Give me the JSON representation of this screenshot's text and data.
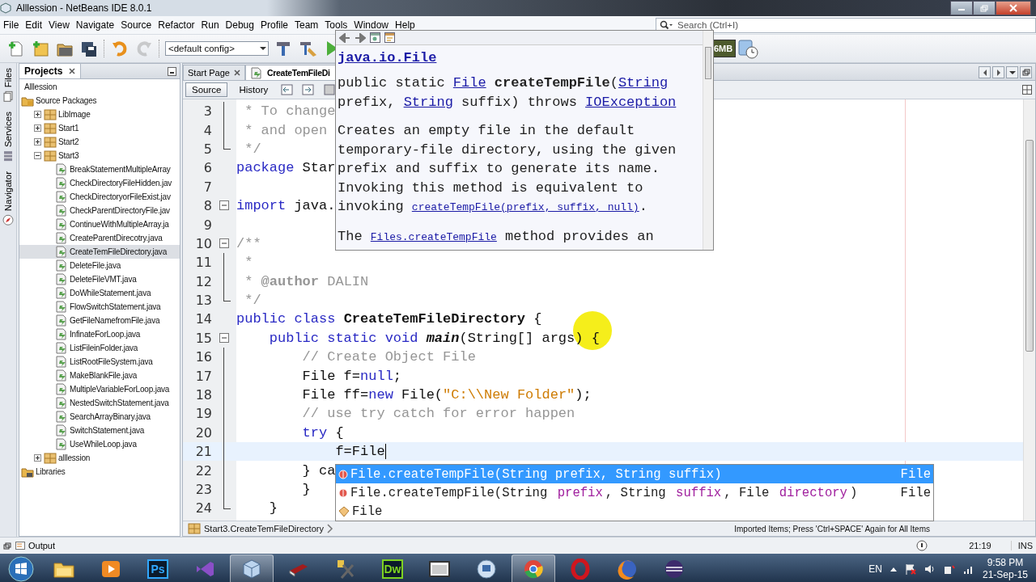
{
  "window": {
    "title": "Alllession - NetBeans IDE 8.0.1"
  },
  "menu": [
    "File",
    "Edit",
    "View",
    "Navigate",
    "Source",
    "Refactor",
    "Run",
    "Debug",
    "Profile",
    "Team",
    "Tools",
    "Window",
    "Help"
  ],
  "search": {
    "placeholder": "Search (Ctrl+I)"
  },
  "toolbar": {
    "config": "<default config>",
    "memory": "6MB",
    "redo_disabled": true
  },
  "side_tabs": [
    {
      "label": "Files",
      "kind": "files"
    },
    {
      "label": "Services",
      "kind": "services"
    },
    {
      "label": "Navigator",
      "kind": "navigator"
    }
  ],
  "projects": {
    "title": "Projects",
    "tree": [
      {
        "label": "Alllession",
        "selected": false,
        "children": [
          {
            "label": "Source Packages",
            "kind": "folder",
            "selected": false,
            "children": [
              {
                "label": "LibImage",
                "kind": "package",
                "expanded": false,
                "selected": false
              },
              {
                "label": "Start1",
                "kind": "package",
                "expanded": false,
                "selected": false
              },
              {
                "label": "Start2",
                "kind": "package",
                "expanded": false,
                "selected": false
              },
              {
                "label": "Start3",
                "kind": "package",
                "expanded": true,
                "selected": false,
                "children": [
                  {
                    "label": "BreakStatementMultipleArray",
                    "kind": "file",
                    "selected": false
                  },
                  {
                    "label": "CheckDirectoryFileHidden.jav",
                    "kind": "file",
                    "selected": false
                  },
                  {
                    "label": "CheckDirectoryorFileExist.jav",
                    "kind": "file",
                    "selected": false
                  },
                  {
                    "label": "CheckParentDirectoryFile.jav",
                    "kind": "file",
                    "selected": false
                  },
                  {
                    "label": "ContinueWithMultipleArray.ja",
                    "kind": "file",
                    "selected": false
                  },
                  {
                    "label": "CreateParentDirecotry.java",
                    "kind": "file",
                    "selected": false
                  },
                  {
                    "label": "CreateTemFileDirectory.java",
                    "kind": "file",
                    "selected": true
                  },
                  {
                    "label": "DeleteFile.java",
                    "kind": "file",
                    "selected": false
                  },
                  {
                    "label": "DeleteFileVMT.java",
                    "kind": "file",
                    "selected": false
                  },
                  {
                    "label": "DoWhileStatement.java",
                    "kind": "file",
                    "selected": false
                  },
                  {
                    "label": "FlowSwitchStatement.java",
                    "kind": "file",
                    "selected": false
                  },
                  {
                    "label": "GetFileNamefromFile.java",
                    "kind": "file",
                    "selected": false
                  },
                  {
                    "label": "InfinateForLoop.java",
                    "kind": "file",
                    "selected": false
                  },
                  {
                    "label": "ListFileinFolder.java",
                    "kind": "file",
                    "selected": false
                  },
                  {
                    "label": "ListRootFileSystem.java",
                    "kind": "file",
                    "selected": false
                  },
                  {
                    "label": "MakeBlankFile.java",
                    "kind": "file",
                    "selected": false
                  },
                  {
                    "label": "MultipleVariableForLoop.java",
                    "kind": "file",
                    "selected": false
                  },
                  {
                    "label": "NestedSwitchStatement.java",
                    "kind": "file",
                    "selected": false
                  },
                  {
                    "label": "SearchArrayBinary.java",
                    "kind": "file",
                    "selected": false
                  },
                  {
                    "label": "SwitchStatement.java",
                    "kind": "file",
                    "selected": false
                  },
                  {
                    "label": "UseWhileLoop.java",
                    "kind": "file",
                    "selected": false
                  }
                ]
              },
              {
                "label": "alllession",
                "kind": "package",
                "expanded": false,
                "selected": false
              }
            ]
          },
          {
            "label": "Libraries",
            "kind": "library",
            "selected": false
          }
        ]
      }
    ]
  },
  "editor": {
    "tabs": [
      {
        "label": "Start Page",
        "selected": false
      },
      {
        "label": "CreateTemFileDi",
        "selected": true
      }
    ],
    "views": [
      {
        "label": "Source",
        "selected": true
      },
      {
        "label": "History",
        "selected": false
      }
    ],
    "lines": [
      {
        "number": "3",
        "kind": "fold_middle",
        "current": false,
        "segments": [
          {
            "text": " * To change",
            "kind": "comment"
          }
        ]
      },
      {
        "number": "4",
        "kind": "fold_middle",
        "current": false,
        "segments": [
          {
            "text": " * and open",
            "kind": "comment"
          }
        ]
      },
      {
        "number": "5",
        "kind": "fold_end",
        "current": false,
        "segments": [
          {
            "text": " */",
            "kind": "comment"
          }
        ]
      },
      {
        "number": "6",
        "kind": "plain",
        "current": false,
        "segments": [
          {
            "text": "package",
            "kind": "keyword"
          },
          {
            "text": " Star",
            "kind": "plain"
          }
        ]
      },
      {
        "number": "7",
        "kind": "plain",
        "current": false
      },
      {
        "number": "8",
        "kind": "fold_start",
        "current": false,
        "segments": [
          {
            "text": "import",
            "kind": "keyword"
          },
          {
            "text": " java.",
            "kind": "plain"
          }
        ]
      },
      {
        "number": "9",
        "kind": "plain",
        "current": false
      },
      {
        "number": "10",
        "kind": "fold_start",
        "current": false,
        "segments": [
          {
            "text": "/**",
            "kind": "comment"
          }
        ]
      },
      {
        "number": "11",
        "kind": "fold_middle",
        "current": false,
        "segments": [
          {
            "text": " *",
            "kind": "comment"
          }
        ]
      },
      {
        "number": "12",
        "kind": "fold_middle",
        "current": false,
        "segments": [
          {
            "text": " * ",
            "kind": "comment"
          },
          {
            "text": "@author",
            "kind": "comment_tag"
          },
          {
            "text": " DALIN",
            "kind": "comment"
          }
        ]
      },
      {
        "number": "13",
        "kind": "fold_end",
        "current": false,
        "segments": [
          {
            "text": " */",
            "kind": "comment"
          }
        ]
      },
      {
        "number": "14",
        "kind": "plain",
        "current": false,
        "segments": [
          {
            "text": "public class ",
            "kind": "keyword"
          },
          {
            "text": "CreateTemFileDirectory",
            "kind": "type_name"
          },
          {
            "text": " {",
            "kind": "plain"
          }
        ]
      },
      {
        "number": "15",
        "kind": "fold_start",
        "current": false,
        "segments": [
          {
            "text": "    public static void ",
            "kind": "keyword"
          },
          {
            "text": "main",
            "kind": "method"
          },
          {
            "text": "(String[] args) {",
            "kind": "plain"
          }
        ]
      },
      {
        "number": "16",
        "kind": "fold_middle",
        "current": false,
        "segments": [
          {
            "text": "        // Create Object File",
            "kind": "comment"
          }
        ]
      },
      {
        "number": "17",
        "kind": "fold_middle",
        "current": false,
        "segments": [
          {
            "text": "        File f=",
            "kind": "plain"
          },
          {
            "text": "null",
            "kind": "keyword"
          },
          {
            "text": ";",
            "kind": "plain"
          }
        ]
      },
      {
        "number": "18",
        "kind": "fold_middle",
        "current": false,
        "segments": [
          {
            "text": "        File ff=",
            "kind": "plain"
          },
          {
            "text": "new",
            "kind": "keyword"
          },
          {
            "text": " File(",
            "kind": "plain"
          },
          {
            "text": "\"C:\\\\New Folder\"",
            "kind": "string"
          },
          {
            "text": ");",
            "kind": "plain"
          }
        ]
      },
      {
        "number": "19",
        "kind": "fold_middle",
        "current": false,
        "segments": [
          {
            "text": "        // use try catch for error happen",
            "kind": "comment"
          }
        ]
      },
      {
        "number": "20",
        "kind": "fold_middle",
        "current": false,
        "segments": [
          {
            "text": "        try",
            "kind": "keyword"
          },
          {
            "text": " {",
            "kind": "plain"
          }
        ]
      },
      {
        "number": "21",
        "kind": "fold_middle",
        "current": true,
        "segments": [
          {
            "text": "            f=File",
            "kind": "plain"
          }
        ]
      },
      {
        "number": "22",
        "kind": "fold_middle",
        "current": false,
        "segments": [
          {
            "text": "        } ca",
            "kind": "plain"
          }
        ]
      },
      {
        "number": "23",
        "kind": "fold_middle",
        "current": false,
        "segments": [
          {
            "text": "        }",
            "kind": "plain"
          }
        ]
      },
      {
        "number": "24",
        "kind": "fold_end",
        "current": false,
        "segments": [
          {
            "text": "    }",
            "kind": "plain"
          }
        ]
      }
    ],
    "breadcrumb": "Start3.CreateTemFileDirectory",
    "hint": "Imported Items; Press 'Ctrl+SPACE' Again for All Items"
  },
  "documentation": {
    "title": "java.io.File",
    "paragraphs": [
      [
        {
          "text": "public static ",
          "kind": "plain"
        },
        {
          "text": "File",
          "kind": "link"
        },
        {
          "text": " createTempFile",
          "kind": "bold"
        },
        {
          "text": "(",
          "kind": "plain"
        },
        {
          "text": "String",
          "kind": "link"
        },
        {
          "text": " prefix, ",
          "kind": "plain"
        },
        {
          "text": "String",
          "kind": "link"
        },
        {
          "text": " suffix) throws ",
          "kind": "plain"
        },
        {
          "text": "IOException",
          "kind": "link"
        }
      ],
      [
        {
          "text": "Creates an empty file in the default temporary-file directory, using the given prefix and suffix to generate its name. Invoking this method is equivalent to invoking ",
          "kind": "plain"
        },
        {
          "text": "createTempFile(prefix, suffix, null)",
          "kind": "small_link"
        },
        {
          "text": ".",
          "kind": "plain"
        }
      ],
      [
        {
          "text": "The ",
          "kind": "plain"
        },
        {
          "text": "Files.createTempFile",
          "kind": "small_link"
        },
        {
          "text": " method provides an",
          "kind": "plain"
        }
      ]
    ]
  },
  "completion": {
    "items": [
      {
        "kind": "method",
        "selected": true,
        "type": "File",
        "segments": [
          {
            "text": "File.createTempFile(String prefix, String suffix)",
            "kind": "plain"
          }
        ]
      },
      {
        "kind": "method",
        "selected": false,
        "type": "File",
        "segments": [
          {
            "text": "File.createTempFile(String ",
            "kind": "plain"
          },
          {
            "text": "prefix",
            "kind": "param"
          },
          {
            "text": ", String ",
            "kind": "plain"
          },
          {
            "text": "suffix",
            "kind": "param"
          },
          {
            "text": ", File ",
            "kind": "plain"
          },
          {
            "text": "directory",
            "kind": "param"
          },
          {
            "text": ")",
            "kind": "plain"
          }
        ]
      },
      {
        "kind": "class",
        "selected": false,
        "segments": [
          {
            "text": "File",
            "kind": "plain"
          }
        ]
      }
    ]
  },
  "status_bar": {
    "panel": "Output",
    "position": "21:19",
    "mode": "INS"
  },
  "taskbar": {
    "apps": [
      {
        "kind": "explorer",
        "active": false
      },
      {
        "kind": "media",
        "active": false
      },
      {
        "kind": "logo",
        "label": "Ps",
        "color": "#31a8ff",
        "active": false
      },
      {
        "kind": "studio",
        "active": false
      },
      {
        "kind": "cube",
        "active": true
      },
      {
        "kind": "book",
        "active": false
      },
      {
        "kind": "tools",
        "active": false
      },
      {
        "kind": "logo",
        "label": "Dw",
        "color": "#7ed321",
        "active": false
      },
      {
        "kind": "window",
        "active": false
      },
      {
        "kind": "remote",
        "active": false
      },
      {
        "kind": "chrome",
        "active": true
      },
      {
        "kind": "opera",
        "active": false
      },
      {
        "kind": "firefox",
        "active": false
      },
      {
        "kind": "eclipse",
        "active": false
      }
    ],
    "language": "EN",
    "time": "9:58 PM",
    "date": "21-Sep-15"
  }
}
